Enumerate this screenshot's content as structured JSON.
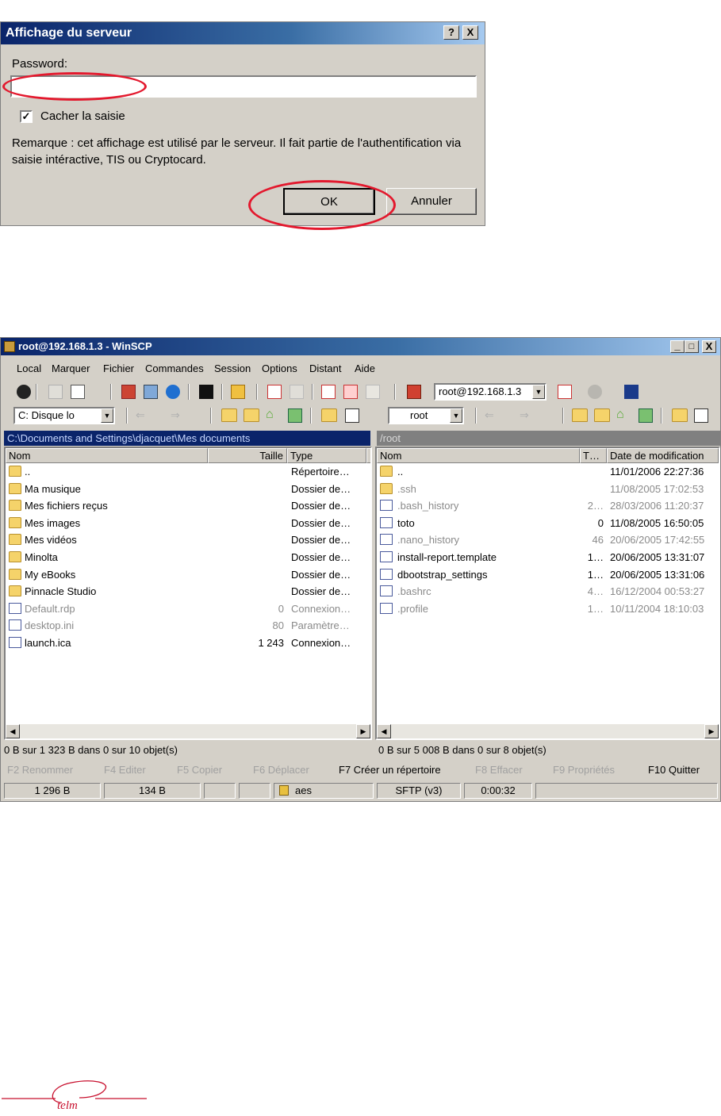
{
  "dialog": {
    "title": "Affichage du serveur",
    "help_button": "?",
    "close_button": "X",
    "password_label": "Password:",
    "password_value": "",
    "hide_input_label": "Cacher la saisie",
    "hide_input_checked": true,
    "remark": "Remarque : cet affichage est utilisé par le serveur. Il fait partie de l'authentification via saisie intéractive, TIS ou Cryptocard.",
    "ok_label": "OK",
    "cancel_label": "Annuler",
    "highlight_color": "#e3182d"
  },
  "winscp": {
    "title": "root@192.168.1.3 - WinSCP",
    "window_controls": [
      "_",
      "□",
      "X"
    ],
    "menu": [
      "Local",
      "Marquer",
      "Fichier",
      "Commandes",
      "Session",
      "Options",
      "Distant",
      "Aide"
    ],
    "session_combo": "root@192.168.1.3",
    "left": {
      "drive_combo": "C: Disque lo",
      "path": "C:\\Documents and Settings\\djacquet\\Mes documents",
      "columns": [
        "Nom",
        "Taille",
        "Type"
      ],
      "rows": [
        {
          "name": "..",
          "size": "",
          "type": "Répertoire…",
          "icon": "parent-dir-icon",
          "dim": false
        },
        {
          "name": "Ma musique",
          "size": "",
          "type": "Dossier de…",
          "icon": "music-folder-icon",
          "dim": false
        },
        {
          "name": "Mes fichiers reçus",
          "size": "",
          "type": "Dossier de…",
          "icon": "folder-icon",
          "dim": false
        },
        {
          "name": "Mes images",
          "size": "",
          "type": "Dossier de…",
          "icon": "pictures-folder-icon",
          "dim": false
        },
        {
          "name": "Mes vidéos",
          "size": "",
          "type": "Dossier de…",
          "icon": "videos-folder-icon",
          "dim": false
        },
        {
          "name": "Minolta",
          "size": "",
          "type": "Dossier de…",
          "icon": "folder-icon",
          "dim": false
        },
        {
          "name": "My eBooks",
          "size": "",
          "type": "Dossier de…",
          "icon": "folder-icon",
          "dim": false
        },
        {
          "name": "Pinnacle Studio",
          "size": "",
          "type": "Dossier de…",
          "icon": "folder-icon",
          "dim": false
        },
        {
          "name": "Default.rdp",
          "size": "0",
          "type": "Connexion…",
          "icon": "rdp-file-icon",
          "dim": true
        },
        {
          "name": "desktop.ini",
          "size": "80",
          "type": "Paramètre…",
          "icon": "ini-file-icon",
          "dim": true
        },
        {
          "name": "launch.ica",
          "size": "1 243",
          "type": "Connexion…",
          "icon": "ica-file-icon",
          "dim": false
        }
      ],
      "status": "0 B sur 1 323 B dans 0 sur 10 objet(s)"
    },
    "right": {
      "dir_combo": "root",
      "path": "/root",
      "columns": [
        "Nom",
        "T…",
        "Date de modification"
      ],
      "rows": [
        {
          "name": "..",
          "size": "",
          "date": "11/01/2006 22:27:36",
          "icon": "parent-dir-icon",
          "dim": false
        },
        {
          "name": ".ssh",
          "size": "",
          "date": "11/08/2005 17:02:53",
          "icon": "folder-icon",
          "dim": true
        },
        {
          "name": ".bash_history",
          "size": "2…",
          "date": "28/03/2006 11:20:37",
          "icon": "file-icon",
          "dim": true
        },
        {
          "name": "toto",
          "size": "0",
          "date": "11/08/2005 16:50:05",
          "icon": "file-icon",
          "dim": false
        },
        {
          "name": ".nano_history",
          "size": "46",
          "date": "20/06/2005 17:42:55",
          "icon": "file-icon",
          "dim": true
        },
        {
          "name": "install-report.template",
          "size": "1…",
          "date": "20/06/2005 13:31:07",
          "icon": "file-icon",
          "dim": false
        },
        {
          "name": "dbootstrap_settings",
          "size": "1…",
          "date": "20/06/2005 13:31:06",
          "icon": "file-icon",
          "dim": false
        },
        {
          "name": ".bashrc",
          "size": "4…",
          "date": "16/12/2004 00:53:27",
          "icon": "file-icon",
          "dim": true
        },
        {
          "name": ".profile",
          "size": "1…",
          "date": "10/11/2004 18:10:03",
          "icon": "file-icon",
          "dim": true
        }
      ],
      "status": "0 B sur 5 008 B dans 0 sur 8 objet(s)"
    },
    "fkeys": [
      {
        "label": "F2 Renommer",
        "enabled": false
      },
      {
        "label": "F4 Editer",
        "enabled": false
      },
      {
        "label": "F5 Copier",
        "enabled": false
      },
      {
        "label": "F6 Déplacer",
        "enabled": false
      },
      {
        "label": "F7 Créer un répertoire",
        "enabled": true
      },
      {
        "label": "F8 Effacer",
        "enabled": false
      },
      {
        "label": "F9 Propriétés",
        "enabled": false
      },
      {
        "label": "F10 Quitter",
        "enabled": true
      }
    ],
    "statusbar": {
      "sent": "1 296 B",
      "received": "134 B",
      "cipher": "aes",
      "protocol": "SFTP (v3)",
      "elapsed": "0:00:32"
    },
    "active_path_color": "#0a246a",
    "inactive_path_color": "#808080"
  },
  "logo": {
    "text": "telm",
    "color": "#c8102e"
  }
}
